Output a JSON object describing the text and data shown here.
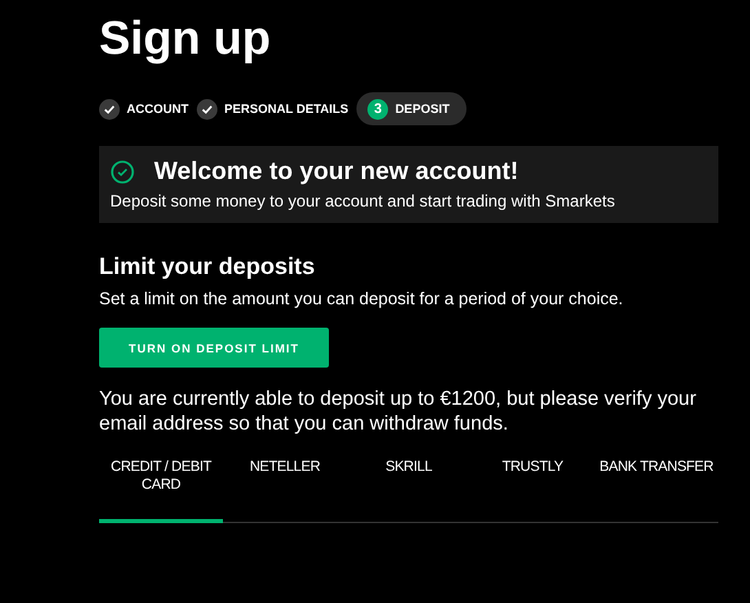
{
  "title": "Sign up",
  "steps": [
    {
      "label": "ACCOUNT",
      "done": true,
      "selected": false
    },
    {
      "label": "PERSONAL DETAILS",
      "done": true,
      "selected": false
    },
    {
      "label": "DEPOSIT",
      "done": false,
      "selected": true,
      "number": "3"
    }
  ],
  "welcome": {
    "title": "Welcome to your new account!",
    "text": "Deposit some money to your account and start trading with Smarkets"
  },
  "limit": {
    "heading": "Limit your deposits",
    "text": "Set a limit on the amount you can deposit for a period of your choice.",
    "button": "TURN ON DEPOSIT LIMIT"
  },
  "notice": "You are currently able to deposit up to €1200, but please verify your email address so that you can withdraw funds.",
  "tabs": [
    {
      "label": "CREDIT / DEBIT CARD",
      "selected": true
    },
    {
      "label": "NETELLER",
      "selected": false
    },
    {
      "label": "SKRILL",
      "selected": false
    },
    {
      "label": "TRUSTLY",
      "selected": false
    },
    {
      "label": "BANK TRANSFER",
      "selected": false
    }
  ]
}
